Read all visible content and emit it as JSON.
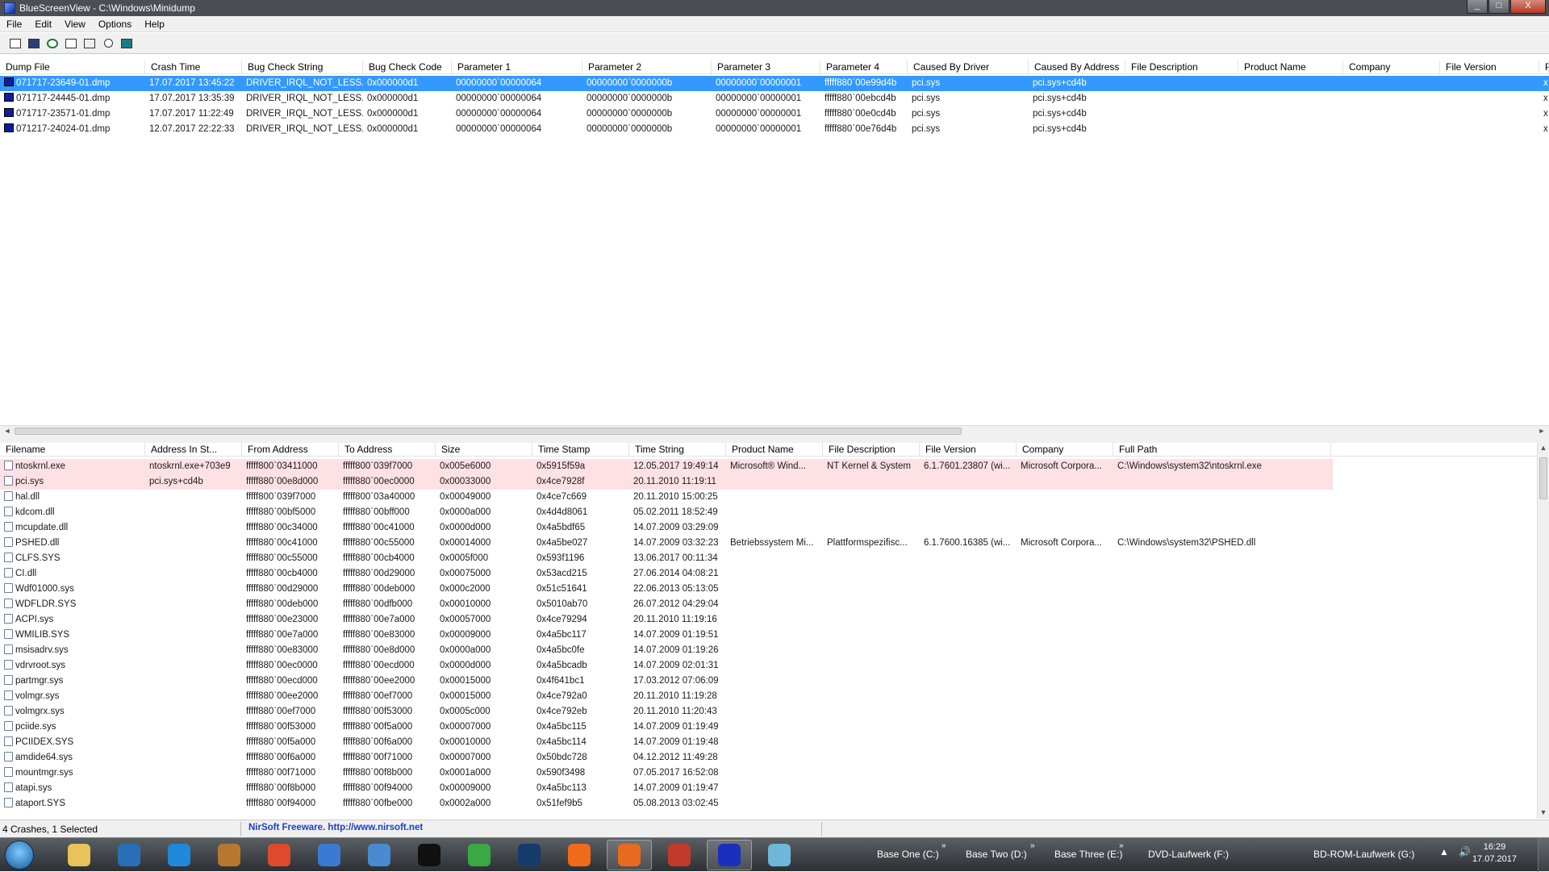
{
  "window": {
    "title": "BlueScreenView  -  C:\\Windows\\Minidump",
    "min": "_",
    "max": "□",
    "close": "X"
  },
  "menu": [
    "File",
    "Edit",
    "View",
    "Options",
    "Help"
  ],
  "toolbar": [
    "save-selected-icon",
    "save-icon",
    "refresh-icon",
    "copy-icon",
    "properties-icon",
    "find-icon",
    "exit-icon"
  ],
  "crashes": {
    "columns": [
      "Dump File",
      "Crash Time",
      "Bug Check String",
      "Bug Check Code",
      "Parameter 1",
      "Parameter 2",
      "Parameter 3",
      "Parameter 4",
      "Caused By Driver",
      "Caused By Address",
      "File Description",
      "Product Name",
      "Company",
      "File Version",
      "P"
    ],
    "sort_indicator": "▽",
    "rows": [
      [
        "071717-23649-01.dmp",
        "17.07.2017 13:45:22",
        "DRIVER_IRQL_NOT_LESS...",
        "0x000000d1",
        "00000000`00000064",
        "00000000`0000000b",
        "00000000`00000001",
        "fffff880`00e99d4b",
        "pci.sys",
        "pci.sys+cd4b",
        "x"
      ],
      [
        "071717-24445-01.dmp",
        "17.07.2017 13:35:39",
        "DRIVER_IRQL_NOT_LESS...",
        "0x000000d1",
        "00000000`00000064",
        "00000000`0000000b",
        "00000000`00000001",
        "fffff880`00ebcd4b",
        "pci.sys",
        "pci.sys+cd4b",
        "x"
      ],
      [
        "071717-23571-01.dmp",
        "17.07.2017 11:22:49",
        "DRIVER_IRQL_NOT_LESS...",
        "0x000000d1",
        "00000000`00000064",
        "00000000`0000000b",
        "00000000`00000001",
        "fffff880`00e0cd4b",
        "pci.sys",
        "pci.sys+cd4b",
        "x"
      ],
      [
        "071217-24024-01.dmp",
        "12.07.2017 22:22:33",
        "DRIVER_IRQL_NOT_LESS...",
        "0x000000d1",
        "00000000`00000064",
        "00000000`0000000b",
        "00000000`00000001",
        "fffff880`00e76d4b",
        "pci.sys",
        "pci.sys+cd4b",
        "x"
      ]
    ]
  },
  "modules": {
    "columns": [
      "Filename",
      "Address In St...",
      "From Address",
      "To Address",
      "Size",
      "Time Stamp",
      "Time String",
      "Product Name",
      "File Description",
      "File Version",
      "Company",
      "Full Path"
    ],
    "sort_indicator": "/",
    "rows": [
      [
        "ntoskrnl.exe",
        "ntoskrnl.exe+703e9",
        "fffff800`03411000",
        "fffff800`039f7000",
        "0x005e6000",
        "0x5915f59a",
        "12.05.2017 19:49:14",
        "Microsoft® Wind...",
        "NT Kernel & System",
        "6.1.7601.23807 (wi...",
        "Microsoft Corpora...",
        "C:\\Windows\\system32\\ntoskrnl.exe"
      ],
      [
        "pci.sys",
        "pci.sys+cd4b",
        "fffff880`00e8d000",
        "fffff880`00ec0000",
        "0x00033000",
        "0x4ce7928f",
        "20.11.2010 11:19:11",
        "",
        "",
        "",
        "",
        ""
      ],
      [
        "hal.dll",
        "",
        "fffff800`039f7000",
        "fffff800`03a40000",
        "0x00049000",
        "0x4ce7c669",
        "20.11.2010 15:00:25",
        "",
        "",
        "",
        "",
        ""
      ],
      [
        "kdcom.dll",
        "",
        "fffff880`00bf5000",
        "fffff880`00bff000",
        "0x0000a000",
        "0x4d4d8061",
        "05.02.2011 18:52:49",
        "",
        "",
        "",
        "",
        ""
      ],
      [
        "mcupdate.dll",
        "",
        "fffff880`00c34000",
        "fffff880`00c41000",
        "0x0000d000",
        "0x4a5bdf65",
        "14.07.2009 03:29:09",
        "",
        "",
        "",
        "",
        ""
      ],
      [
        "PSHED.dll",
        "",
        "fffff880`00c41000",
        "fffff880`00c55000",
        "0x00014000",
        "0x4a5be027",
        "14.07.2009 03:32:23",
        "Betriebssystem Mi...",
        "Plattformspezifisc...",
        "6.1.7600.16385 (wi...",
        "Microsoft Corpora...",
        "C:\\Windows\\system32\\PSHED.dll"
      ],
      [
        "CLFS.SYS",
        "",
        "fffff880`00c55000",
        "fffff880`00cb4000",
        "0x0005f000",
        "0x593f1196",
        "13.06.2017 00:11:34",
        "",
        "",
        "",
        "",
        ""
      ],
      [
        "CI.dll",
        "",
        "fffff880`00cb4000",
        "fffff880`00d29000",
        "0x00075000",
        "0x53acd215",
        "27.06.2014 04:08:21",
        "",
        "",
        "",
        "",
        ""
      ],
      [
        "Wdf01000.sys",
        "",
        "fffff880`00d29000",
        "fffff880`00deb000",
        "0x000c2000",
        "0x51c51641",
        "22.06.2013 05:13:05",
        "",
        "",
        "",
        "",
        ""
      ],
      [
        "WDFLDR.SYS",
        "",
        "fffff880`00deb000",
        "fffff880`00dfb000",
        "0x00010000",
        "0x5010ab70",
        "26.07.2012 04:29:04",
        "",
        "",
        "",
        "",
        ""
      ],
      [
        "ACPI.sys",
        "",
        "fffff880`00e23000",
        "fffff880`00e7a000",
        "0x00057000",
        "0x4ce79294",
        "20.11.2010 11:19:16",
        "",
        "",
        "",
        "",
        ""
      ],
      [
        "WMILIB.SYS",
        "",
        "fffff880`00e7a000",
        "fffff880`00e83000",
        "0x00009000",
        "0x4a5bc117",
        "14.07.2009 01:19:51",
        "",
        "",
        "",
        "",
        ""
      ],
      [
        "msisadrv.sys",
        "",
        "fffff880`00e83000",
        "fffff880`00e8d000",
        "0x0000a000",
        "0x4a5bc0fe",
        "14.07.2009 01:19:26",
        "",
        "",
        "",
        "",
        ""
      ],
      [
        "vdrvroot.sys",
        "",
        "fffff880`00ec0000",
        "fffff880`00ecd000",
        "0x0000d000",
        "0x4a5bcadb",
        "14.07.2009 02:01:31",
        "",
        "",
        "",
        "",
        ""
      ],
      [
        "partmgr.sys",
        "",
        "fffff880`00ecd000",
        "fffff880`00ee2000",
        "0x00015000",
        "0x4f641bc1",
        "17.03.2012 07:06:09",
        "",
        "",
        "",
        "",
        ""
      ],
      [
        "volmgr.sys",
        "",
        "fffff880`00ee2000",
        "fffff880`00ef7000",
        "0x00015000",
        "0x4ce792a0",
        "20.11.2010 11:19:28",
        "",
        "",
        "",
        "",
        ""
      ],
      [
        "volmgrx.sys",
        "",
        "fffff880`00ef7000",
        "fffff880`00f53000",
        "0x0005c000",
        "0x4ce792eb",
        "20.11.2010 11:20:43",
        "",
        "",
        "",
        "",
        ""
      ],
      [
        "pciide.sys",
        "",
        "fffff880`00f53000",
        "fffff880`00f5a000",
        "0x00007000",
        "0x4a5bc115",
        "14.07.2009 01:19:49",
        "",
        "",
        "",
        "",
        ""
      ],
      [
        "PCIIDEX.SYS",
        "",
        "fffff880`00f5a000",
        "fffff880`00f6a000",
        "0x00010000",
        "0x4a5bc114",
        "14.07.2009 01:19:48",
        "",
        "",
        "",
        "",
        ""
      ],
      [
        "amdide64.sys",
        "",
        "fffff880`00f6a000",
        "fffff880`00f71000",
        "0x00007000",
        "0x50bdc728",
        "04.12.2012 11:49:28",
        "",
        "",
        "",
        "",
        ""
      ],
      [
        "mountmgr.sys",
        "",
        "fffff880`00f71000",
        "fffff880`00f8b000",
        "0x0001a000",
        "0x590f3498",
        "07.05.2017 16:52:08",
        "",
        "",
        "",
        "",
        ""
      ],
      [
        "atapi.sys",
        "",
        "fffff880`00f8b000",
        "fffff880`00f94000",
        "0x00009000",
        "0x4a5bc113",
        "14.07.2009 01:19:47",
        "",
        "",
        "",
        "",
        ""
      ],
      [
        "ataport.SYS",
        "",
        "fffff880`00f94000",
        "fffff880`00fbe000",
        "0x0002a000",
        "0x51fef9b5",
        "05.08.2013 03:02:45",
        "",
        "",
        "",
        "",
        ""
      ]
    ]
  },
  "status": {
    "summary": "4 Crashes, 1 Selected",
    "credit": "NirSoft Freeware.  http://www.nirsoft.net"
  },
  "taskbar": {
    "apps": [
      "explorer-icon",
      "thunderbird-icon",
      "media-player-icon",
      "game-icon",
      "chrome-icon",
      "network-icon",
      "settings-icon",
      "media-center-icon",
      "xbox-icon",
      "steam-icon",
      "origin-icon",
      "firefox-icon",
      "vivaldi-icon",
      "bluescreenview-icon",
      "tablet-icon"
    ],
    "drives": [
      "Base One (C:)",
      "Base Two (D:)",
      "Base Three (E:)",
      "DVD-Laufwerk (F:)",
      "BD-ROM-Laufwerk (G:)"
    ],
    "time": "16:29",
    "date": "17.07.2017"
  }
}
